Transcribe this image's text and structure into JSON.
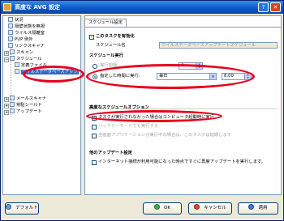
{
  "window": {
    "title": "高度な AVG 設定"
  },
  "tree": {
    "items": [
      {
        "label": "状況"
      },
      {
        "label": "隔壁状態を無視"
      },
      {
        "label": "ウイルス隔離室"
      },
      {
        "label": "PUP 例外"
      },
      {
        "label": "リンクスキャナ"
      },
      {
        "label": "スキャン"
      },
      {
        "label": "スケジュール"
      },
      {
        "label": "定義ファイル"
      },
      {
        "label": "ウイルスデータベースアップ"
      },
      {
        "label": "メールスキャナ"
      },
      {
        "label": "常駐シールド"
      },
      {
        "label": "アップデート"
      }
    ]
  },
  "tab": {
    "label": "スケジュール設定"
  },
  "schedule": {
    "enable_label": "このタスクを有効化",
    "name_label": "スケジュール名",
    "name_value": "ウイルスデータベースアップデートスケジュール",
    "run_heading": "スケジュール実行",
    "option_interval": "実行間隔:",
    "interval_value": "4",
    "option_specific": "指定した時間に実行:",
    "every_value": "毎日",
    "time_value": "8:00",
    "advanced_heading": "高度なスケジュールオプション",
    "missed_task_label": "タスクが実行されなかった場合はコンピュータ起動時に実行",
    "power_label": "バッテリーモードでも実行する",
    "fullscreen_label": "全画面アプリケーションが実行中の場合は、このタスクは延期します",
    "auto_update_heading": "他のアップデート設定",
    "auto_update_label": "インターネット接続が利用可能になった時点ですぐに再度アップデートを実行します。"
  },
  "buttons": {
    "default": "デフォルト",
    "ok": "OK",
    "cancel": "キャンセル",
    "apply": "適用"
  },
  "colors": {
    "highlight_red": "#e8001c",
    "title_blue": "#0a57c7",
    "selection": "#316ac5"
  }
}
